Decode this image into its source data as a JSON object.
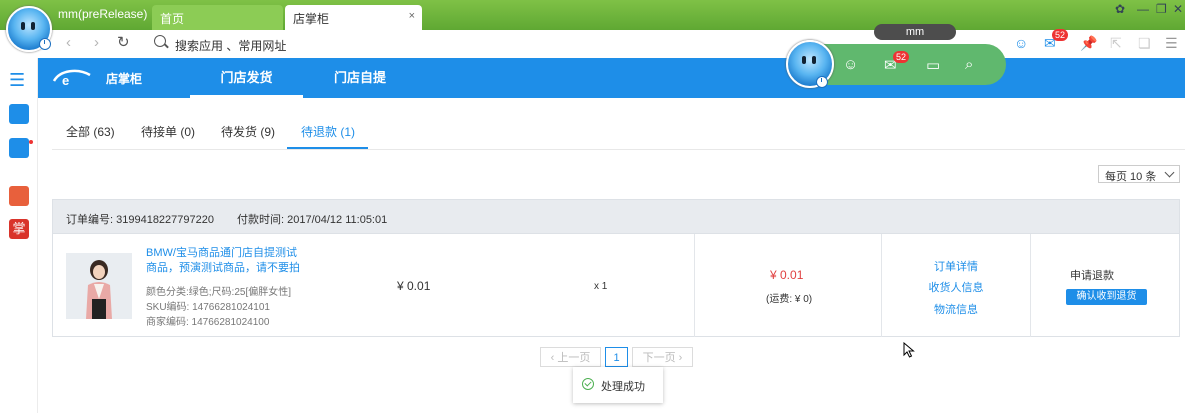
{
  "browser": {
    "user_name": "mm(preRelease)",
    "tabs": [
      {
        "label": "首页"
      },
      {
        "label": "店掌柜",
        "close": "×"
      }
    ],
    "address_placeholder": "搜索应用 、常用网址",
    "mail_count": "52"
  },
  "widget": {
    "label": "mm",
    "mail_count": "52"
  },
  "header": {
    "brand": "店掌柜",
    "nav": [
      {
        "label": "门店发货",
        "active": true
      },
      {
        "label": "门店自提",
        "active": false
      }
    ]
  },
  "subtabs": [
    {
      "label": "全部 (63)"
    },
    {
      "label": "待接单 (0)"
    },
    {
      "label": "待发货 (9)"
    },
    {
      "label": "待退款 (1)",
      "active": true
    }
  ],
  "page_size": "每页 10 条",
  "order": {
    "order_no": "订单编号: 3199418227797220",
    "pay_time": "付款时间: 2017/04/12 11:05:01",
    "product_title": "BMW/宝马商品通门店自提测试商品，预演测试商品，请不要拍",
    "sku_props": "颜色分类:绿色;尺码:25[偏胖女性]",
    "sku_code": "SKU编码: 14766281024101",
    "merchant_code": "商家编码: 14766281024100",
    "price": "¥ 0.01",
    "quantity": "x 1",
    "total": "¥ 0.01",
    "shipping": "(运费: ¥ 0)",
    "links": [
      "订单详情",
      "收货人信息",
      "物流信息"
    ],
    "status": "申请退款",
    "action": "确认收到退货"
  },
  "pagination": {
    "prev": "上一页",
    "current": "1",
    "next": "下一页"
  },
  "toast": "处理成功",
  "colors": {
    "accent": "#1e8ee8",
    "titlebar": "#6db53c",
    "widget": "#60b86e",
    "price": "#e04040"
  }
}
